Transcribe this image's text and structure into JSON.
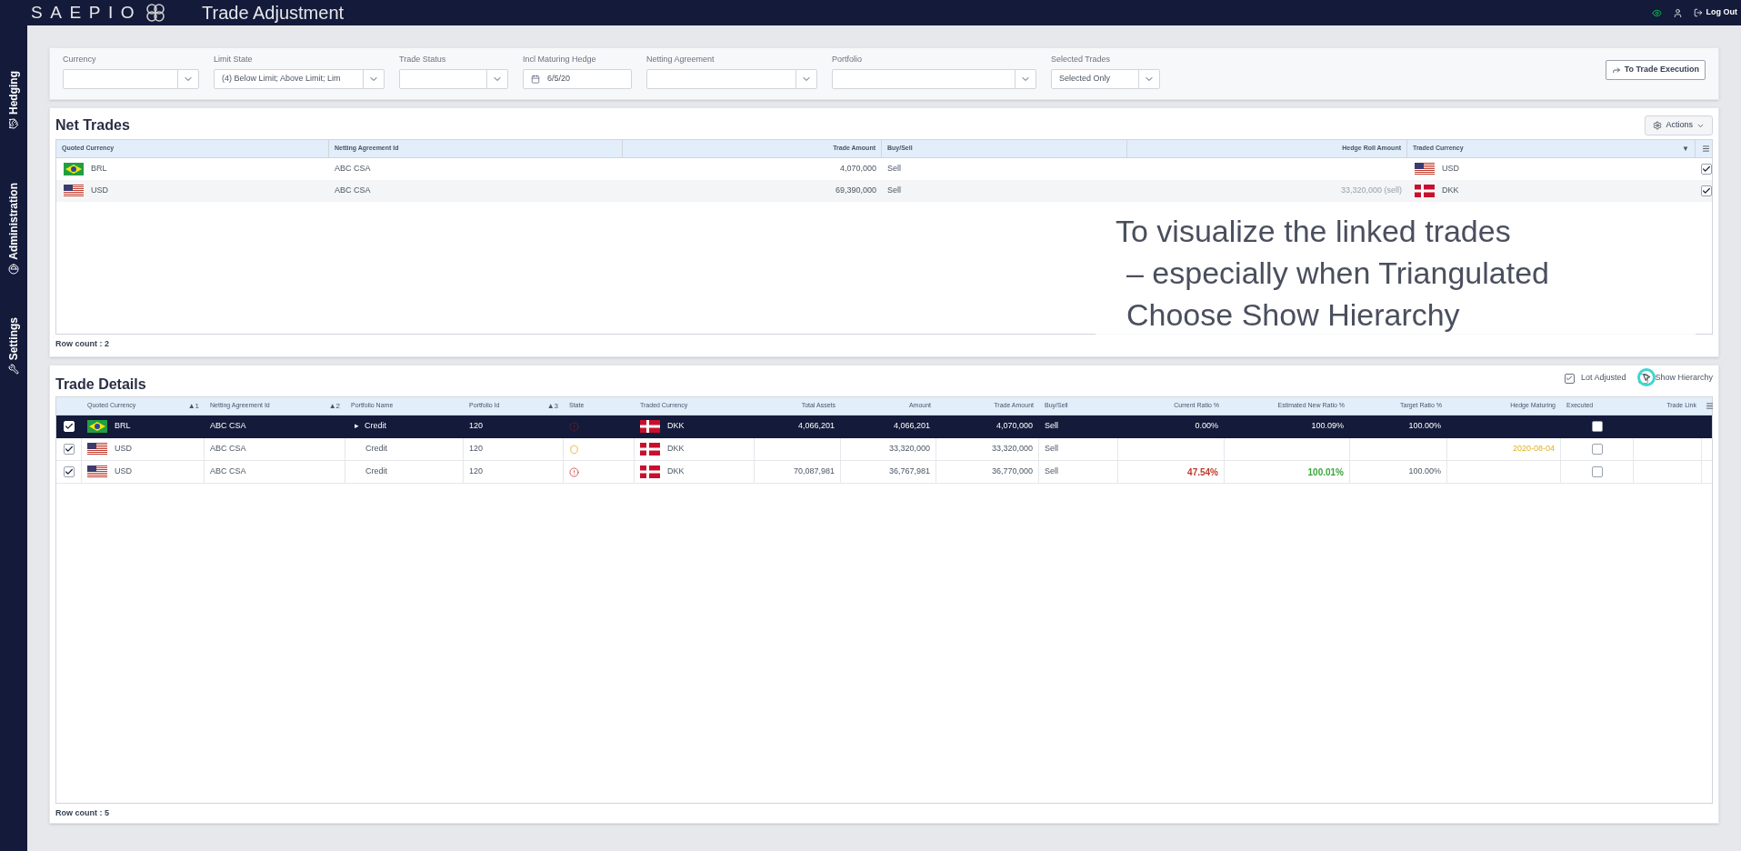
{
  "app": {
    "logo": "SAEPIO",
    "title": "Trade Adjustment",
    "logout": "Log Out"
  },
  "sidebar": [
    {
      "label": "Hedging"
    },
    {
      "label": "Administration"
    },
    {
      "label": "Settings"
    }
  ],
  "filters": [
    {
      "label": "Currency",
      "kind": "select"
    },
    {
      "label": "Limit State",
      "kind": "select",
      "value": "(4) Below Limit; Above Limit; Lim"
    },
    {
      "label": "Trade Status",
      "kind": "select"
    },
    {
      "label": "Incl Maturing Hedge",
      "kind": "date",
      "value": "6/5/20"
    },
    {
      "label": "Netting Agreement",
      "kind": "select"
    },
    {
      "label": "Portfolio",
      "kind": "select"
    },
    {
      "label": "Selected Trades",
      "kind": "select",
      "value": "Selected Only"
    }
  ],
  "execute_button": "To Trade Execution",
  "net_trades": {
    "title": "Net Trades",
    "actions": "Actions",
    "columns": [
      {
        "label": "Quoted Currency"
      },
      {
        "label": "Netting Agreement Id"
      },
      {
        "label": "Trade Amount"
      },
      {
        "label": "Buy/Sell"
      },
      {
        "label": "Hedge Roll Amount"
      },
      {
        "label": "Traded Currency",
        "sort": "▼"
      }
    ],
    "rows": [
      {
        "currency": "BRL",
        "netting": "ABC CSA",
        "trade_amount": "4,070,000",
        "buy_sell": "Sell",
        "traded": "USD",
        "checked": true
      },
      {
        "currency": "USD",
        "netting": "ABC CSA",
        "trade_amount": "69,390,000",
        "buy_sell": "Sell",
        "hedge_roll": "33,320,000 (sell)",
        "traded": "DKK",
        "checked": true
      }
    ],
    "row_count": "Row count : 2"
  },
  "caption": [
    "To visualize the linked trades",
    "– especially when Triangulated",
    "Choose Show Hierarchy"
  ],
  "trade_details": {
    "title": "Trade Details",
    "options": [
      {
        "label": "Lot Adjusted",
        "checked": true
      },
      {
        "label": "Show Hierarchy",
        "checked": false
      }
    ],
    "columns": [
      {
        "label": "Quoted Currency",
        "sort": "▲1"
      },
      {
        "label": "Netting Agreement Id",
        "sort": "▲2"
      },
      {
        "label": "Portfolio Name"
      },
      {
        "label": "Portfolio Id",
        "sort": "▲3"
      },
      {
        "label": "State"
      },
      {
        "label": "Traded Currency"
      },
      {
        "label": "Total Assets"
      },
      {
        "label": "Amount"
      },
      {
        "label": "Trade Amount"
      },
      {
        "label": "Buy/Sell"
      },
      {
        "label": "Current Ratio %"
      },
      {
        "label": "Estimated New Ratio %"
      },
      {
        "label": "Target Ratio %"
      },
      {
        "label": "Hedge Maturing"
      },
      {
        "label": "Executed"
      },
      {
        "label": "Trade Link"
      }
    ],
    "rows": [
      {
        "selected": true,
        "checked": true,
        "currency": "BRL",
        "netting": "ABC CSA",
        "expander": "▸",
        "portfolio": "Credit",
        "portfolio_id": "120",
        "state": {
          "kind": "alert"
        },
        "traded": "DKK",
        "total_assets": "4,066,201",
        "amount": "4,066,201",
        "trade_amount": "4,070,000",
        "buy_sell": "Sell",
        "current_ratio": {
          "text": "0.00%"
        },
        "estimated_ratio": {
          "text": "100.09%"
        },
        "target_ratio": "100.00%",
        "executed": false
      },
      {
        "selected": false,
        "checked": true,
        "currency": "USD",
        "netting": "ABC CSA",
        "portfolio": "Credit",
        "portfolio_id": "120",
        "state": {
          "kind": "shield"
        },
        "traded": "DKK",
        "amount": "33,320,000",
        "trade_amount": "33,320,000",
        "buy_sell": "Sell",
        "hedge_maturing": "2020-08-04",
        "executed": false
      },
      {
        "selected": false,
        "checked": true,
        "currency": "USD",
        "netting": "ABC CSA",
        "portfolio": "Credit",
        "portfolio_id": "120",
        "state": {
          "kind": "alert"
        },
        "traded": "DKK",
        "total_assets": "70,087,981",
        "amount": "36,767,981",
        "trade_amount": "36,770,000",
        "buy_sell": "Sell",
        "current_ratio": {
          "text": "47.54%",
          "color": "#c0392b"
        },
        "estimated_ratio": {
          "text": "100.01%",
          "color": "#3aa53a"
        },
        "target_ratio": "100.00%",
        "executed": false
      }
    ],
    "row_count": "Row count : 5"
  }
}
